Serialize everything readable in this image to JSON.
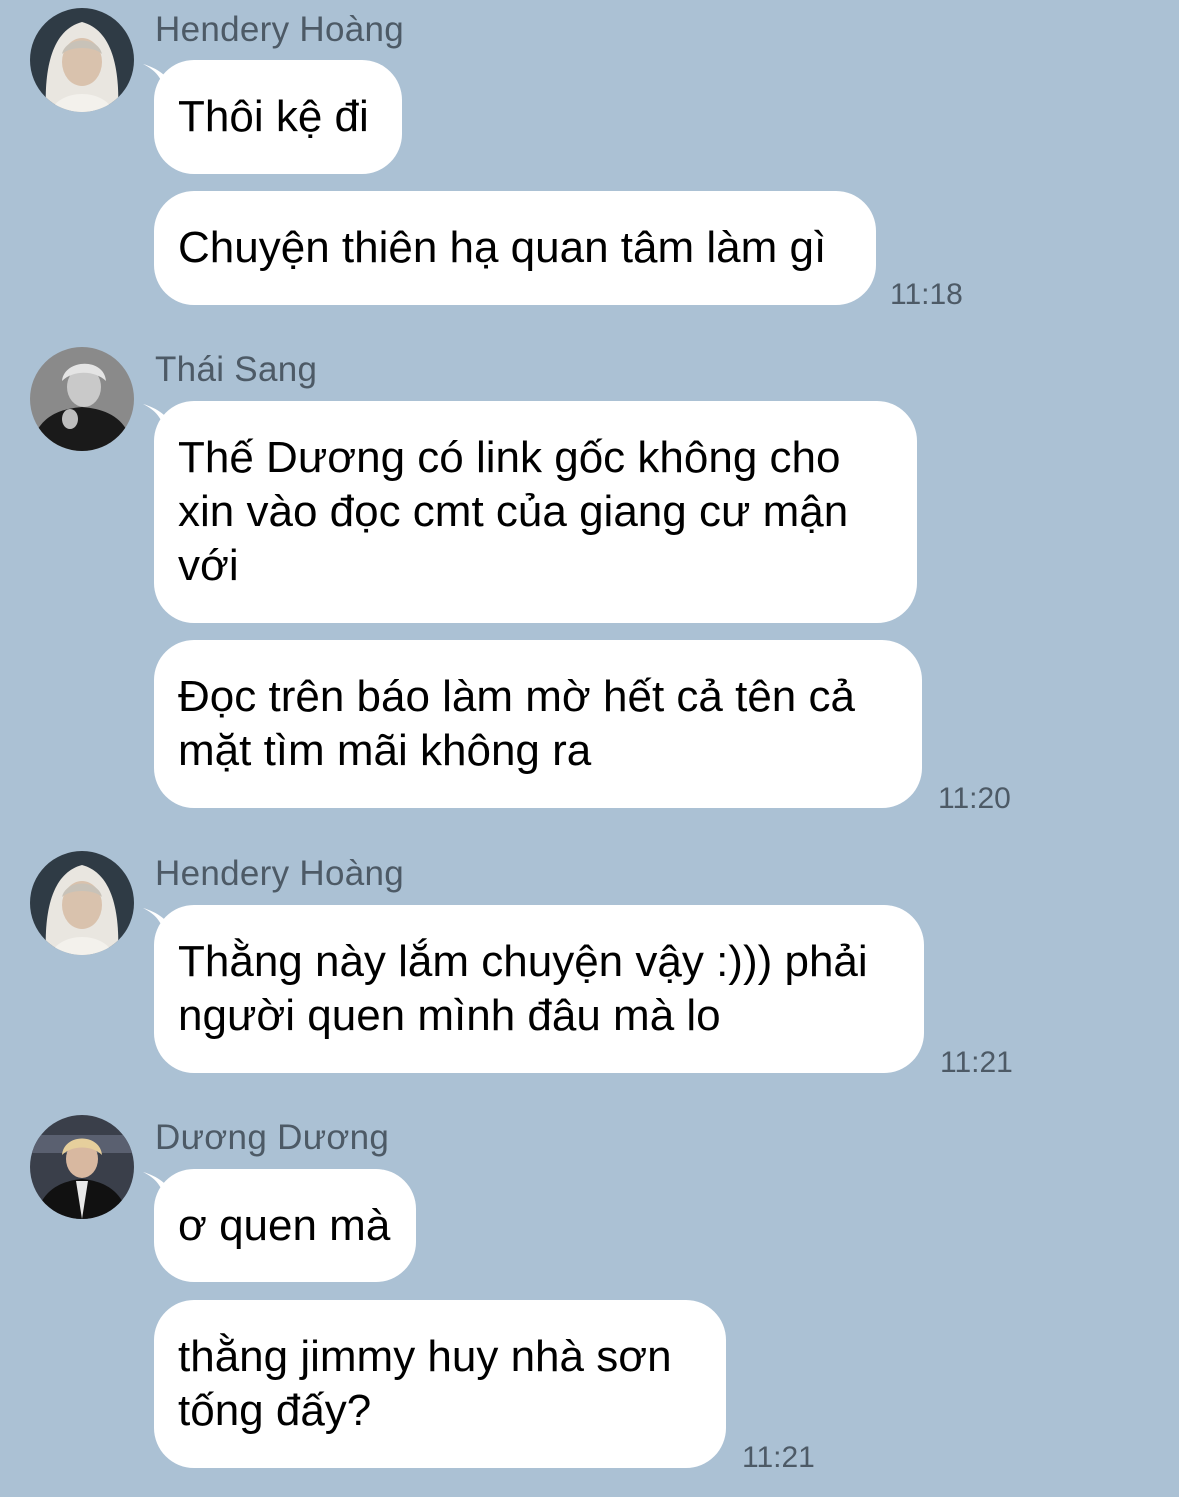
{
  "colors": {
    "background": "#abc1d4",
    "bubble": "#ffffff",
    "meta_text": "#4d5a66"
  },
  "groups": [
    {
      "sender": "Hendery Hoàng",
      "avatar": "avatar-hendery-icon",
      "messages": [
        "Thôi kệ đi",
        "Chuyện thiên hạ quan tâm làm gì"
      ],
      "time": "11:18"
    },
    {
      "sender": "Thái Sang",
      "avatar": "avatar-thai-sang-icon",
      "messages": [
        "Thế Dương có link gốc không cho\nxin vào đọc cmt của giang cư mận\nvới",
        "Đọc trên báo làm mờ hết cả tên cả\nmặt tìm mãi không ra"
      ],
      "time": "11:20"
    },
    {
      "sender": "Hendery Hoàng",
      "avatar": "avatar-hendery-icon",
      "messages": [
        "Thằng này lắm chuyện vậy :))) phải\nngười quen mình đâu mà lo"
      ],
      "time": "11:21"
    },
    {
      "sender": "Dương Dương",
      "avatar": "avatar-duong-duong-icon",
      "messages": [
        "ơ quen mà",
        "thằng jimmy huy nhà sơn\ntống đấy?"
      ],
      "time": "11:21"
    }
  ]
}
